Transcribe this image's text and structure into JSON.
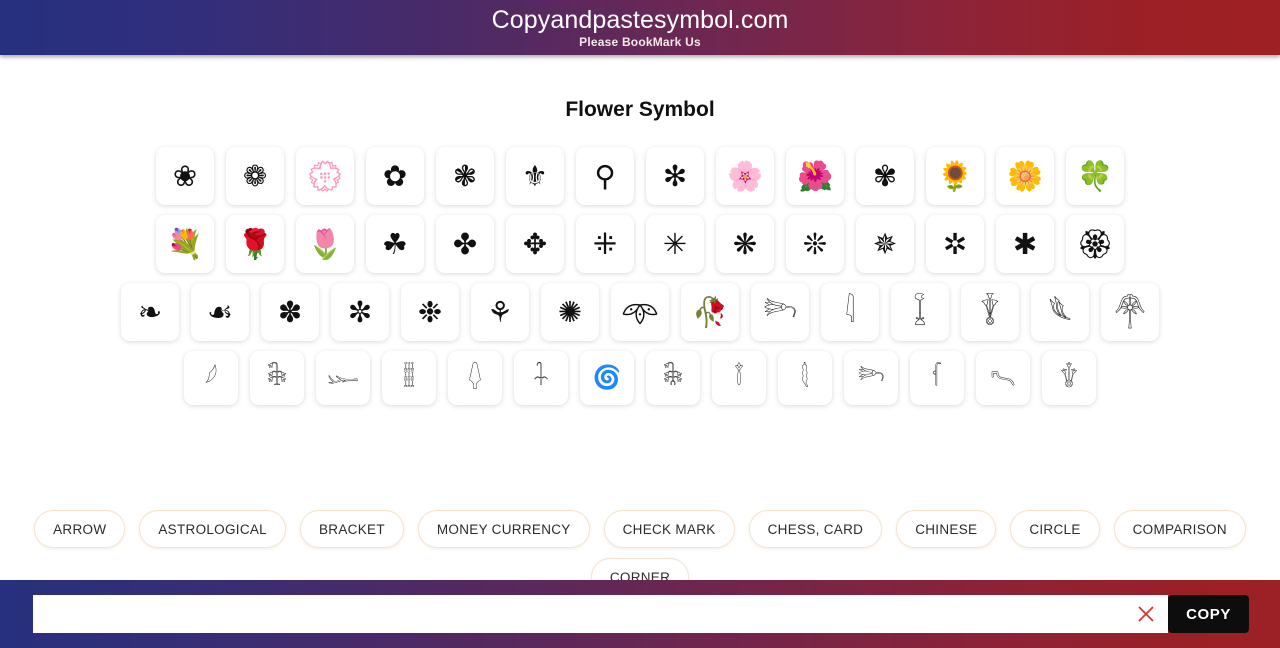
{
  "header": {
    "title": "Copyandpastesymbol.com",
    "tagline": "Please BookMark Us",
    "gradient_from": "#26307e",
    "gradient_to": "#9e2024"
  },
  "main": {
    "heading": "Flower Symbol",
    "symbol_rows": [
      {
        "size": "sz-m",
        "symbols": [
          "❀",
          "❁",
          "💮",
          "✿",
          "❃",
          "⚜",
          "⚲",
          "✻",
          "🌸",
          "🌺",
          "✾",
          "🌻",
          "🌼",
          "🍀"
        ]
      },
      {
        "size": "sz-m",
        "symbols": [
          "💐",
          "🌹",
          "🌷",
          "☘",
          "✤",
          "✥",
          "⁜",
          "✳",
          "❋",
          "❊",
          "✵",
          "✲",
          "✱",
          "🏵"
        ]
      },
      {
        "size": "sz-m",
        "symbols": [
          "❧",
          "☙",
          "✽",
          "✼",
          "❉",
          "⚘",
          "✺",
          "𖥸",
          "🥀",
          "𓆸",
          "𓇋",
          "𓆼",
          "𓇊",
          "𓆰",
          "𓋇"
        ]
      },
      {
        "size": "sz-s",
        "symbols": [
          "𓆪",
          "𓇗",
          "𓆱",
          "𓇄",
          "𓆭",
          "𓇑",
          "🌀",
          "𓇙",
          "𓇕",
          "𓇛",
          "𓆸",
          "𓆳",
          "𓍇",
          "𓇚"
        ]
      }
    ]
  },
  "categories": {
    "items": [
      "ARROW",
      "ASTROLOGICAL",
      "BRACKET",
      "MONEY CURRENCY",
      "CHECK MARK",
      "CHESS, CARD",
      "CHINESE",
      "CIRCLE",
      "COMPARISON",
      "CORNER"
    ]
  },
  "copy_bar": {
    "input_value": "",
    "input_placeholder": "",
    "clear_label": "×",
    "copy_label": "COPY",
    "clear_color": "#d6342c",
    "button_bg": "#0d0d0d"
  }
}
